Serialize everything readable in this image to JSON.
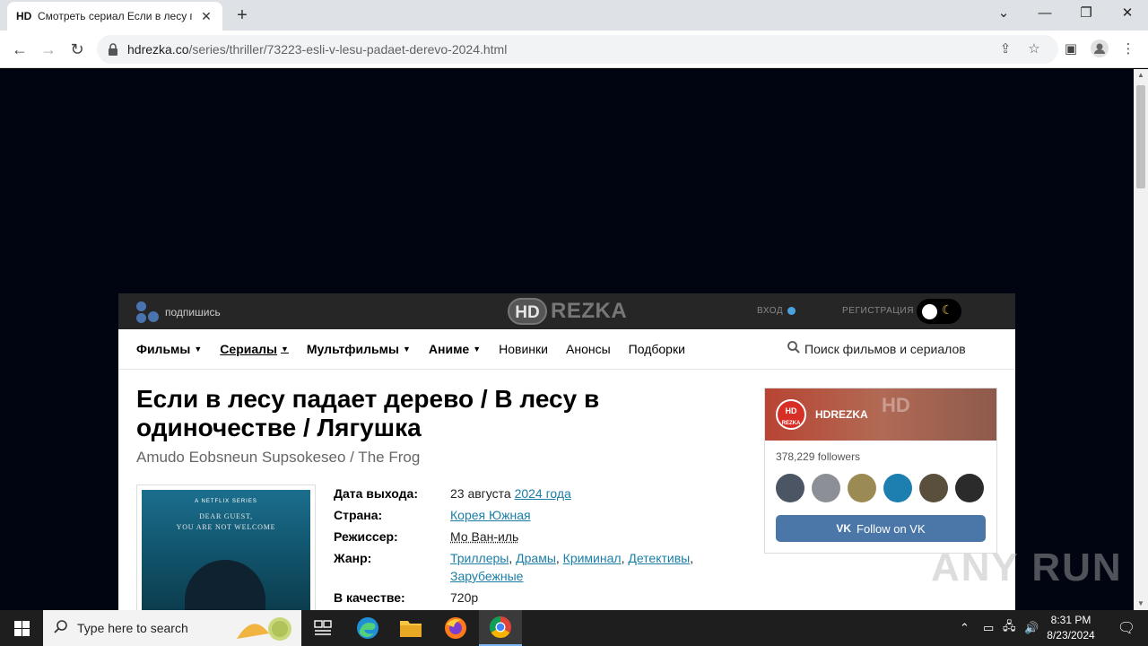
{
  "browser": {
    "tab": {
      "favicon": "HD",
      "title": "Смотреть сериал Если в лесу падает дерево"
    },
    "url_domain": "hdrezka.co",
    "url_path": "/series/thriller/73223-esli-v-lesu-padaet-derevo-2024.html",
    "icons": [
      "back-icon",
      "forward-icon",
      "reload-icon",
      "lock-icon",
      "share-icon",
      "star-icon",
      "sidepanel-icon",
      "profile-icon",
      "menu-icon"
    ]
  },
  "site": {
    "subscribe": "подпишись",
    "logo_hd": "HD",
    "logo_text": "REZKA",
    "login": "ВХОД",
    "register": "РЕГИСТРАЦИЯ",
    "menu": [
      {
        "label": "Фильмы",
        "bold": true,
        "dropdown": true
      },
      {
        "label": "Сериалы",
        "bold": true,
        "dropdown": true,
        "active": true
      },
      {
        "label": "Мультфильмы",
        "bold": true,
        "dropdown": true
      },
      {
        "label": "Аниме",
        "bold": true,
        "dropdown": true
      },
      {
        "label": "Новинки",
        "bold": false
      },
      {
        "label": "Анонсы",
        "bold": false
      },
      {
        "label": "Подборки",
        "bold": false
      }
    ],
    "search_placeholder": "Поиск фильмов и сериалов"
  },
  "movie": {
    "title": "Если в лесу падает дерево / В лесу в одиночестве / Лягушка",
    "original_title": "Amudo Eobsneun Supsokeseo / The Frog",
    "poster": {
      "tag": "A NETFLIX SERIES",
      "line1": "DEAR GUEST,",
      "line2": "YOU ARE NOT WELCOME"
    },
    "info": {
      "release_label": "Дата выхода:",
      "release_day": "23 августа",
      "release_year": "2024 года",
      "country_label": "Страна:",
      "country": "Корея Южная",
      "director_label": "Режиссер:",
      "director": "Мо Ван-иль",
      "genre_label": "Жанр:",
      "genres": [
        "Триллеры",
        "Драмы",
        "Криминал",
        "Детективы",
        "Зарубежные"
      ],
      "quality_label": "В качестве:",
      "quality": "720p"
    }
  },
  "vk_widget": {
    "name": "HDREZKA",
    "avatar_text_1": "HD",
    "avatar_text_2": "REZKA",
    "followers": "378,229 followers",
    "button": "Follow on VK",
    "avatar_colors": [
      "#4b5564",
      "#8d8f96",
      "#9c8a55",
      "#1c7fb0",
      "#5a4e3c",
      "#2b2b2b"
    ]
  },
  "watermark": "ANY RUN",
  "taskbar": {
    "search_placeholder": "Type here to search",
    "time": "8:31 PM",
    "date": "8/23/2024"
  }
}
